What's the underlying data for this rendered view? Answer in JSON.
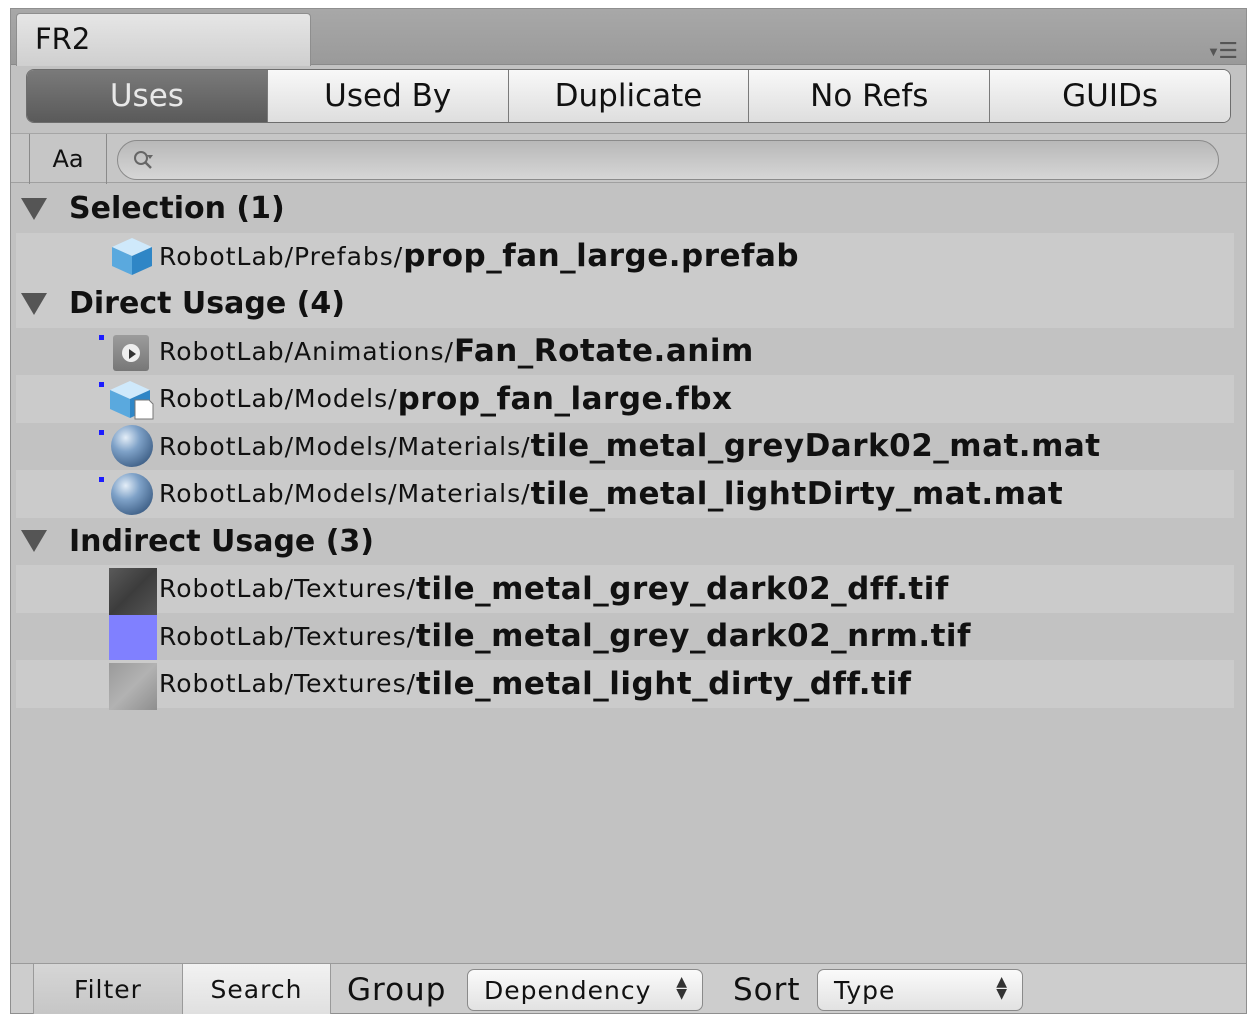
{
  "window": {
    "tab_title": "FR2",
    "menu_icon": "menu-lines-icon"
  },
  "mode_tabs": {
    "uses": "Uses",
    "used_by": "Used By",
    "duplicate": "Duplicate",
    "no_refs": "No Refs",
    "guids": "GUIDs",
    "active": "Uses"
  },
  "toolbar": {
    "case_toggle": "Aa",
    "search_value": "",
    "search_icon": "magnifier-icon"
  },
  "groups": {
    "selection": {
      "label": "Selection (1)",
      "items": [
        {
          "path": "RobotLab/Prefabs/",
          "name": "prop_fan_large.prefab",
          "icon": "prefab-cube-icon"
        }
      ]
    },
    "direct": {
      "label": "Direct Usage (4)",
      "items": [
        {
          "path": "RobotLab/Animations/",
          "name": "Fan_Rotate.anim",
          "icon": "animation-clip-icon"
        },
        {
          "path": "RobotLab/Models/",
          "name": "prop_fan_large.fbx",
          "icon": "model-icon"
        },
        {
          "path": "RobotLab/Models/Materials/",
          "name": "tile_metal_greyDark02_mat.mat",
          "icon": "material-sphere-icon"
        },
        {
          "path": "RobotLab/Models/Materials/",
          "name": "tile_metal_lightDirty_mat.mat",
          "icon": "material-sphere-icon"
        }
      ]
    },
    "indirect": {
      "label": "Indirect Usage (3)",
      "items": [
        {
          "path": "RobotLab/Textures/",
          "name": "tile_metal_grey_dark02_dff.tif",
          "icon": "texture-dark-icon"
        },
        {
          "path": "RobotLab/Textures/",
          "name": "tile_metal_grey_dark02_nrm.tif",
          "icon": "texture-normal-icon"
        },
        {
          "path": "RobotLab/Textures/",
          "name": "tile_metal_light_dirty_dff.tif",
          "icon": "texture-light-icon"
        }
      ]
    }
  },
  "bottom": {
    "filter": "Filter",
    "search": "Search",
    "group_label": "Group",
    "group_value": "Dependency",
    "sort_label": "Sort",
    "sort_value": "Type"
  },
  "colors": {
    "panel": "#c2c2c2",
    "active_tab": "#656565",
    "dirty_marker": "#1c1cff",
    "normal_map": "#8080ff"
  }
}
